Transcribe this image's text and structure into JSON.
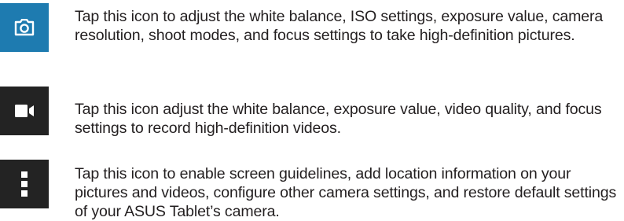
{
  "items": [
    {
      "icon": "camera-settings-icon",
      "icon_bg": "#1e7bb0",
      "description": "Tap this icon to adjust the white balance, ISO settings, exposure value, camera resolution, shoot modes, and focus settings to take high-definition pictures."
    },
    {
      "icon": "video-settings-icon",
      "icon_bg": "#232323",
      "description": "Tap this icon adjust the white balance, exposure value, video quality, and focus settings to record high-definition videos."
    },
    {
      "icon": "more-settings-icon",
      "icon_bg": "#232323",
      "description": "Tap this icon to enable screen guidelines, add location information on your pictures and videos, configure other camera settings, and restore default settings of your ASUS Tablet’s camera."
    }
  ]
}
